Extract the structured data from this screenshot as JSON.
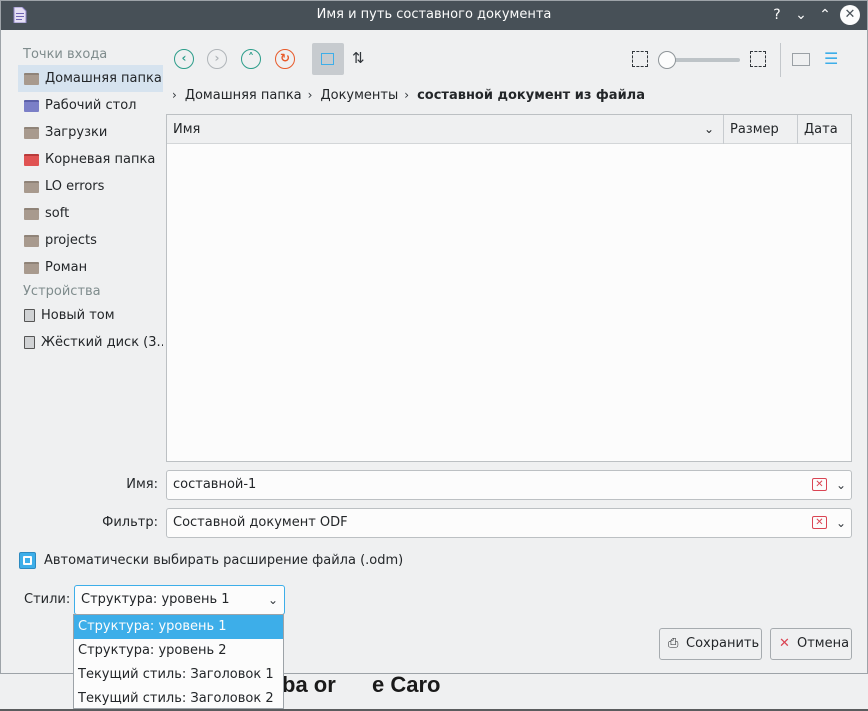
{
  "window": {
    "title": "Имя и путь составного документа"
  },
  "titlebar": {
    "help": "?",
    "minimize": "⌄",
    "maximize": "⌃",
    "close": "✕"
  },
  "sidebar": {
    "places_heading": "Точки входа",
    "places": [
      {
        "label": "Домашняя папка",
        "icon": "home-folder-icon"
      },
      {
        "label": "Рабочий стол",
        "icon": "desktop-folder-icon"
      },
      {
        "label": "Загрузки",
        "icon": "downloads-folder-icon"
      },
      {
        "label": "Корневая папка",
        "icon": "root-folder-icon"
      },
      {
        "label": "LO errors",
        "icon": "folder-icon"
      },
      {
        "label": "soft",
        "icon": "folder-icon"
      },
      {
        "label": "projects",
        "icon": "folder-icon"
      },
      {
        "label": "Роман",
        "icon": "folder-icon"
      }
    ],
    "devices_heading": "Устройства",
    "devices": [
      {
        "label": "Новый том",
        "icon": "drive-icon"
      },
      {
        "label": "Жёсткий диск (3...",
        "icon": "harddisk-icon"
      }
    ]
  },
  "breadcrumb": {
    "items": [
      "Домашняя папка",
      "Документы"
    ],
    "current": "составной документ из файла"
  },
  "fileview": {
    "columns": [
      "Имя",
      "Размер",
      "Дата"
    ]
  },
  "form": {
    "name_label": "Имя:",
    "name_value": "составной-1",
    "filter_label": "Фильтр:",
    "filter_value": "Составной документ ODF",
    "auto_ext_label": "Автоматически выбирать расширение файла (.odm)",
    "auto_ext_checked": true,
    "styles_label": "Стили:",
    "styles_value": "Структура: уровень 1",
    "styles_options": [
      "Структура: уровень 1",
      "Структура: уровень 2",
      "Текущий стиль: Заголовок 1",
      "Текущий стиль: Заголовок 2"
    ]
  },
  "buttons": {
    "save": "Сохранить",
    "cancel": "Отмена"
  },
  "background": {
    "text_a": "ba or",
    "text_b": "e Caro"
  },
  "colors": {
    "accent": "#3daee9",
    "titlebar": "#475057",
    "selection": "#d6e3ef"
  }
}
